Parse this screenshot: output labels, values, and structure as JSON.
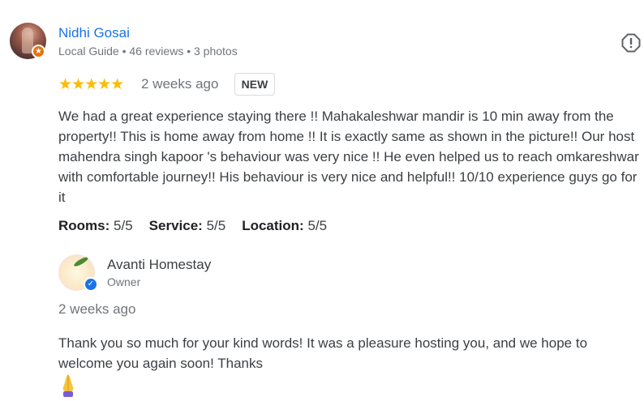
{
  "review": {
    "reviewer_name": "Nidhi Gosai",
    "reviewer_meta": "Local Guide • 46 reviews • 3 photos",
    "stars": "★★★★★",
    "rating": 5,
    "time": "2 weeks ago",
    "badge": "NEW",
    "text": "We had a great experience staying there !! Mahakaleshwar mandir is 10 min away from the property!! This is home away from home !! It is exactly same as shown in the picture!! Our host mahendra singh kapoor 's behaviour was very nice !! He even helped us to reach omkareshwar with comfortable journey!! His behaviour is very nice and helpful!! 10/10 experience guys go for it",
    "subratings": [
      {
        "label": "Rooms:",
        "value": "5/5"
      },
      {
        "label": "Service:",
        "value": "5/5"
      },
      {
        "label": "Location:",
        "value": "5/5"
      }
    ]
  },
  "owner_response": {
    "name": "Avanti Homestay",
    "role": "Owner",
    "time": "2 weeks ago",
    "text": "Thank you so much for your kind words! It was a pleasure hosting you, and we hope to welcome you again soon! Thanks",
    "emoji": "🙏"
  },
  "icons": {
    "guide_badge": "star-badge-icon",
    "flag": "report-flag-icon",
    "verified": "verified-check-icon"
  },
  "colors": {
    "link": "#1a73e8",
    "star": "#fbbc04",
    "guide_badge": "#e8710a",
    "muted": "#70757a"
  }
}
